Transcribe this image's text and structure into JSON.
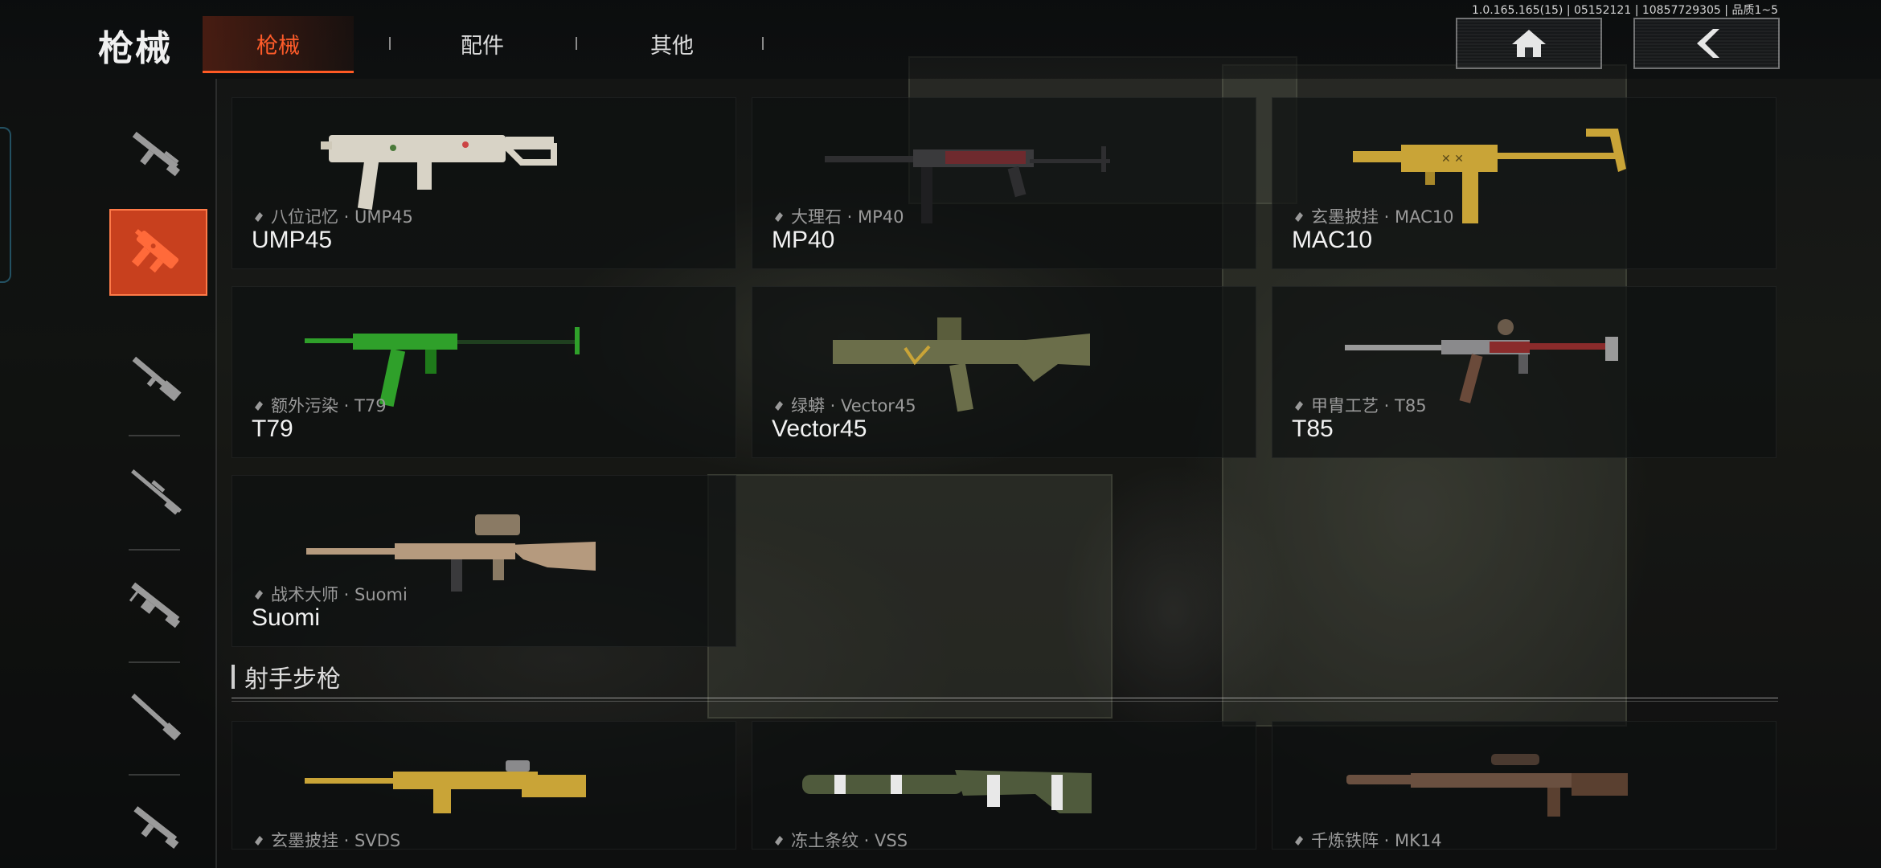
{
  "header": {
    "title": "枪械",
    "tabs": [
      {
        "label": "枪械",
        "active": true
      },
      {
        "label": "配件",
        "active": false
      },
      {
        "label": "其他",
        "active": false
      }
    ],
    "version_text": "1.0.165.165(15) | 05152121 | 10857729305 | 品质1~5",
    "home_icon": "home-icon",
    "back_icon": "back-chevron-icon"
  },
  "sidebar": {
    "active_index": 1,
    "items": [
      {
        "icon": "assault-rifle-icon"
      },
      {
        "icon": "smg-icon"
      },
      {
        "icon": "shotgun-icon"
      },
      {
        "icon": "sniper-rifle-icon"
      },
      {
        "icon": "light-machine-gun-icon"
      },
      {
        "icon": "marksman-rifle-icon"
      },
      {
        "icon": "carbine-icon"
      }
    ]
  },
  "weapons": [
    {
      "skin": "八位记忆 · UMP45",
      "name": "UMP45",
      "color": "#d8d3c6"
    },
    {
      "skin": "大理石 · MP40",
      "name": "MP40",
      "color": "#3a3a3c"
    },
    {
      "skin": "玄墨披挂 · MAC10",
      "name": "MAC10",
      "color": "#c9a437"
    },
    {
      "skin": "额外污染 · T79",
      "name": "T79",
      "color": "#2fa02a"
    },
    {
      "skin": "绿蟒 · Vector45",
      "name": "Vector45",
      "color": "#6b6e4a"
    },
    {
      "skin": "甲胄工艺 · T85",
      "name": "T85",
      "color": "#8a2b2b"
    },
    {
      "skin": "战术大师 · Suomi",
      "name": "Suomi",
      "color": "#b59a7e"
    }
  ],
  "section": {
    "title": "射手步枪"
  },
  "marksman": [
    {
      "skin": "玄墨披挂 · SVDS",
      "color": "#c9a437"
    },
    {
      "skin": "冻土条纹 · VSS",
      "color": "#4f5a3c"
    },
    {
      "skin": "千炼铁阵 · MK14",
      "color": "#6a5040"
    }
  ]
}
